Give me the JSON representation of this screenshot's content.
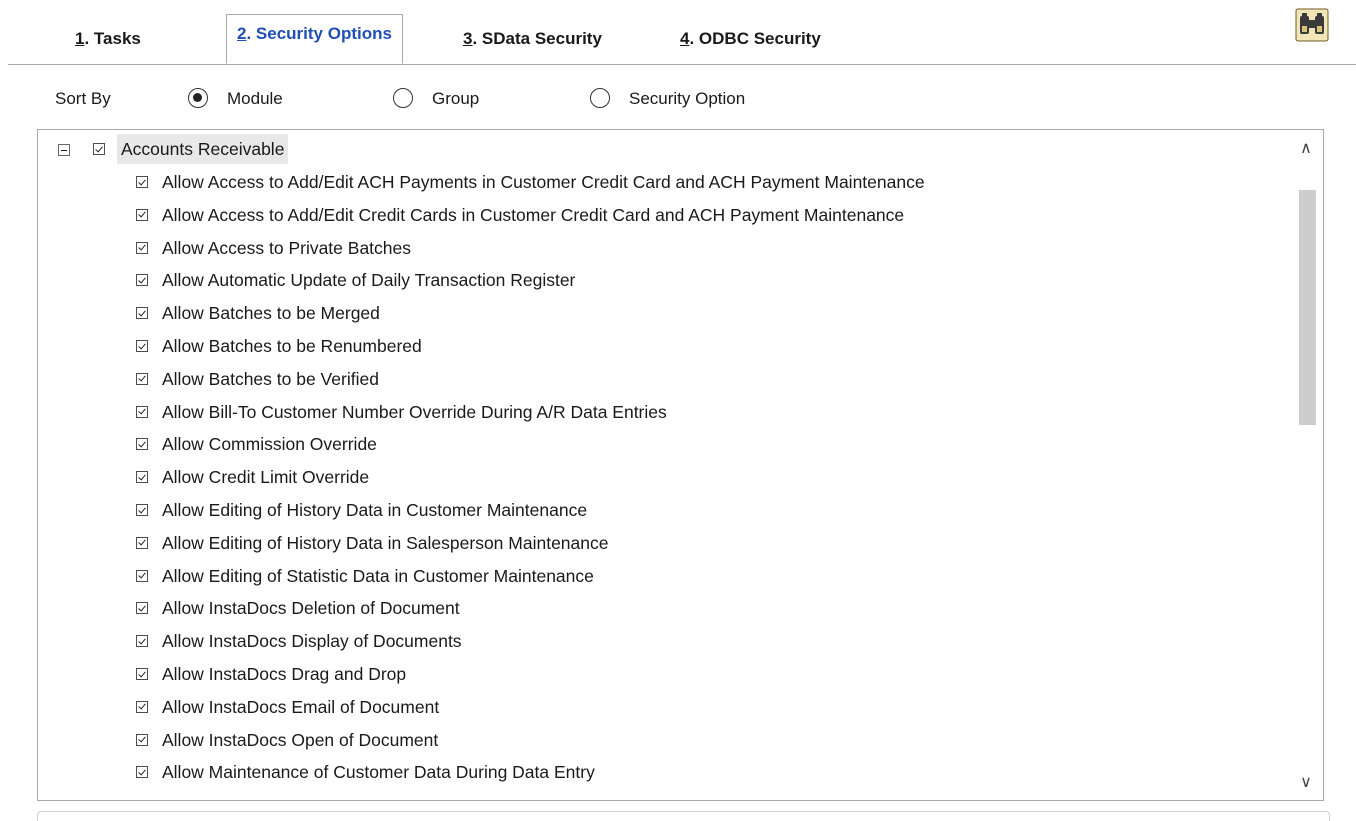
{
  "tabs": [
    {
      "key": "1",
      "label": ". Tasks",
      "active": false
    },
    {
      "key": "2",
      "label": ". Security Options",
      "active": true
    },
    {
      "key": "3",
      "label": ". SData Security",
      "active": false
    },
    {
      "key": "4",
      "label": ". ODBC Security",
      "active": false
    }
  ],
  "sort": {
    "label": "Sort By",
    "options": [
      "Module",
      "Group",
      "Security Option"
    ],
    "selected": "Module"
  },
  "tree": {
    "group": {
      "label": "Accounts Receivable",
      "checked": true,
      "expanded": true
    },
    "items": [
      "Allow Access to Add/Edit ACH Payments in Customer Credit Card and ACH Payment Maintenance",
      "Allow Access to Add/Edit Credit Cards in Customer Credit Card and ACH Payment Maintenance",
      "Allow Access to Private Batches",
      "Allow Automatic Update of Daily Transaction Register",
      "Allow Batches to be Merged",
      "Allow Batches to be Renumbered",
      "Allow Batches to be Verified",
      "Allow Bill-To Customer Number Override During A/R Data Entries",
      "Allow Commission Override",
      "Allow Credit Limit Override",
      "Allow Editing of History Data in Customer Maintenance",
      "Allow Editing of History Data in Salesperson Maintenance",
      "Allow Editing of Statistic Data in Customer Maintenance",
      "Allow InstaDocs Deletion of Document",
      "Allow InstaDocs Display of Documents",
      "Allow InstaDocs Drag and Drop",
      "Allow InstaDocs Email of Document",
      "Allow InstaDocs Open of Document",
      "Allow Maintenance of Customer Data During Data Entry"
    ]
  },
  "icons": {
    "find": "binoculars-icon",
    "scroll_up": "chevron-up-icon",
    "scroll_down": "chevron-down-icon"
  },
  "colors": {
    "active_tab": "#1f4fb6",
    "border": "#a9a9a9",
    "group_highlight": "#e8e8e8",
    "scroll_thumb": "#cdcdcd"
  }
}
